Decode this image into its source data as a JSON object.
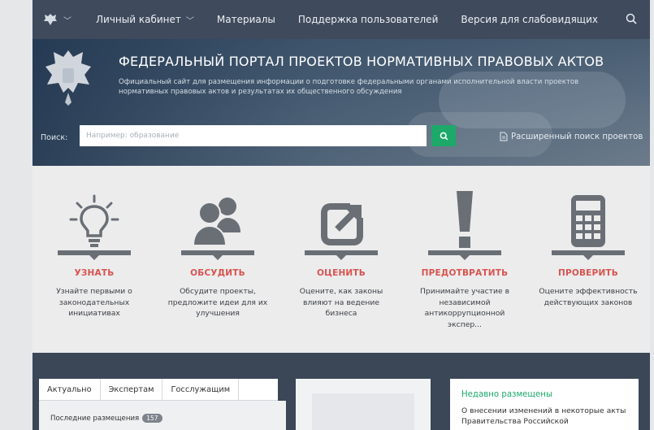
{
  "nav": {
    "account": "Личный кабинет",
    "materials": "Материалы",
    "support": "Поддержка пользователей",
    "accessible": "Версия для слабовидящих"
  },
  "hero": {
    "title": "ФЕДЕРАЛЬНЫЙ ПОРТАЛ ПРОЕКТОВ НОРМАТИВНЫХ ПРАВОВЫХ АКТОВ",
    "subtitle": "Официальный сайт для размещения информации о подготовке федеральными органами исполнительной власти проектов нормативных правовых актов и результатах их общественного обсуждения"
  },
  "search": {
    "label": "Поиск:",
    "placeholder": "Например: образование",
    "advanced": "Расширенный поиск проектов"
  },
  "features": [
    {
      "icon": "lightbulb-icon",
      "title": "УЗНАТЬ",
      "text": "Узнайте первыми о законодательных инициативах"
    },
    {
      "icon": "users-icon",
      "title": "ОБСУДИТЬ",
      "text": "Обсудите проекты, предложите идеи для их улучшения"
    },
    {
      "icon": "external-arrow-icon",
      "title": "ОЦЕНИТЬ",
      "text": "Оцените, как законы влияют на ведение бизнеса"
    },
    {
      "icon": "exclamation-icon",
      "title": "ПРЕДОТВРАТИТЬ",
      "text": "Принимайте участие в независимой антикоррупционной экспер..."
    },
    {
      "icon": "calculator-icon",
      "title": "ПРОВЕРИТЬ",
      "text": "Оцените эффективность действующих законов"
    }
  ],
  "tabs": {
    "items": [
      "Актуально",
      "Экспертам",
      "Госслужащим"
    ],
    "recent_label": "Последние размещения",
    "recent_count": "157"
  },
  "recent_panel": {
    "title": "Недавно размещены",
    "text": "О внесении изменений в некоторые акты Правительства Российской"
  },
  "colors": {
    "nav_bg": "#3f4a5c",
    "accent_green": "#1ca96a",
    "feature_red": "#d9534f",
    "icon_gray": "#6a6f76"
  }
}
